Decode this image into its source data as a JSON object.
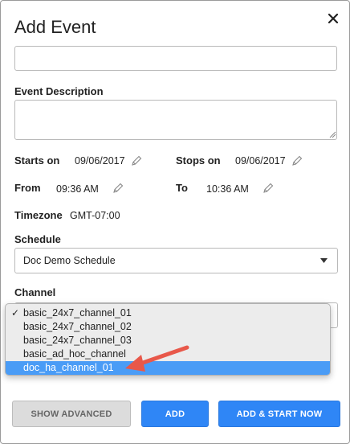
{
  "dialog": {
    "title": "Add Event",
    "close_icon": "close-icon"
  },
  "name_field": {
    "value": "",
    "placeholder": ""
  },
  "description": {
    "label": "Event Description",
    "value": ""
  },
  "starts_on": {
    "label": "Starts on",
    "value": "09/06/2017"
  },
  "stops_on": {
    "label": "Stops on",
    "value": "09/06/2017"
  },
  "from": {
    "label": "From",
    "value": "09:36 AM"
  },
  "to": {
    "label": "To",
    "value": "10:36 AM"
  },
  "timezone": {
    "label": "Timezone",
    "value": "GMT-07:00"
  },
  "schedule": {
    "label": "Schedule",
    "selected": "Doc Demo Schedule"
  },
  "channel": {
    "label": "Channel",
    "options": [
      {
        "label": "basic_24x7_channel_01",
        "checked": "✓"
      },
      {
        "label": "basic_24x7_channel_02",
        "checked": ""
      },
      {
        "label": "basic_24x7_channel_03",
        "checked": ""
      },
      {
        "label": "basic_ad_hoc_channel",
        "checked": ""
      },
      {
        "label": "doc_ha_channel_01",
        "checked": ""
      }
    ],
    "highlighted_index": 4
  },
  "buttons": {
    "show_advanced": "SHOW ADVANCED",
    "add": "ADD",
    "add_and_start": "ADD & START NOW"
  },
  "colors": {
    "primary": "#2f86f6",
    "highlight": "#4a9cf6",
    "annotation_arrow": "#e8584a"
  }
}
